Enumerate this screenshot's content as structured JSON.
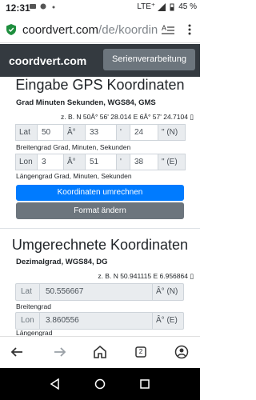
{
  "status_bar": {
    "time": "12:31",
    "network": "LTE⁺",
    "battery": "45 %"
  },
  "browser": {
    "url_host": "coordvert.com",
    "url_path": "/de/koordin",
    "tab_count": "2"
  },
  "site": {
    "brand": "coordvert.com",
    "serien_button": "Serienverarbeitung"
  },
  "input_section": {
    "title": "Eingabe GPS Koordinaten",
    "format": "Grad Minuten Sekunden, WGS84, GMS",
    "example": "z. B. N 50Â° 56' 28.014 E 6Â° 57' 24.7104 ▯",
    "lat": {
      "label": "Lat",
      "deg": "50",
      "deg_unit": "Â°",
      "min": "33",
      "min_unit": "'",
      "sec": "24",
      "sec_unit": "\" (N)",
      "caption": "Breitengrad Grad, Minuten, Sekunden"
    },
    "lon": {
      "label": "Lon",
      "deg": "3",
      "deg_unit": "Â°",
      "min": "51",
      "min_unit": "'",
      "sec": "38",
      "sec_unit": "\" (E)",
      "caption": "Längengrad Grad, Minuten, Sekunden"
    },
    "convert_button": "Koordinaten umrechnen",
    "format_button": "Format ändern"
  },
  "output_section": {
    "title": "Umgerechnete Koordinaten",
    "format": "Dezimalgrad, WGS84, DG",
    "example": "z. B. N 50.941115 E 6.956864 ▯",
    "lat": {
      "label": "Lat",
      "value": "50.556667",
      "unit": "Â° (N)",
      "caption": "Breitengrad"
    },
    "lon": {
      "label": "Lon",
      "value": "3.860556",
      "unit": "Â° (E)",
      "caption": "Längengrad"
    }
  },
  "colors": {
    "header_bg": "#343a40",
    "primary": "#007bff",
    "secondary": "#6c757d"
  }
}
